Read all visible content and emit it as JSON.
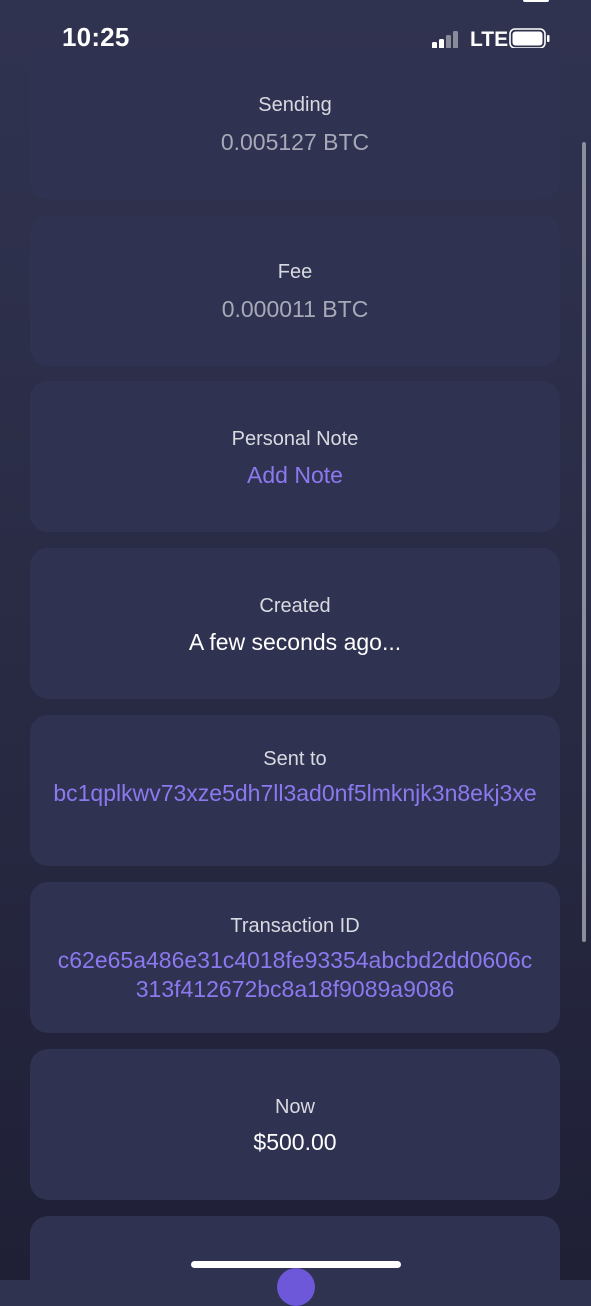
{
  "status_bar": {
    "time": "10:25",
    "network": "LTE"
  },
  "details": {
    "sending": {
      "label": "Sending",
      "value": "0.005127 BTC"
    },
    "fee": {
      "label": "Fee",
      "value": "0.000011 BTC"
    },
    "personal_note": {
      "label": "Personal Note",
      "action": "Add Note"
    },
    "created": {
      "label": "Created",
      "value": "A few seconds ago..."
    },
    "sent_to": {
      "label": "Sent to",
      "value": "bc1qplkwv73xze5dh7ll3ad0nf5lmknjk3n8ekj3xe"
    },
    "transaction_id": {
      "label": "Transaction ID",
      "value": "c62e65a486e31c4018fe93354abcbd2dd0606c313f412672bc8a18f9089a9086"
    },
    "now": {
      "label": "Now",
      "value": "$500.00"
    }
  },
  "colors": {
    "background": "#2a2c46",
    "card": "#2f3250",
    "accent": "#8c79f0"
  }
}
